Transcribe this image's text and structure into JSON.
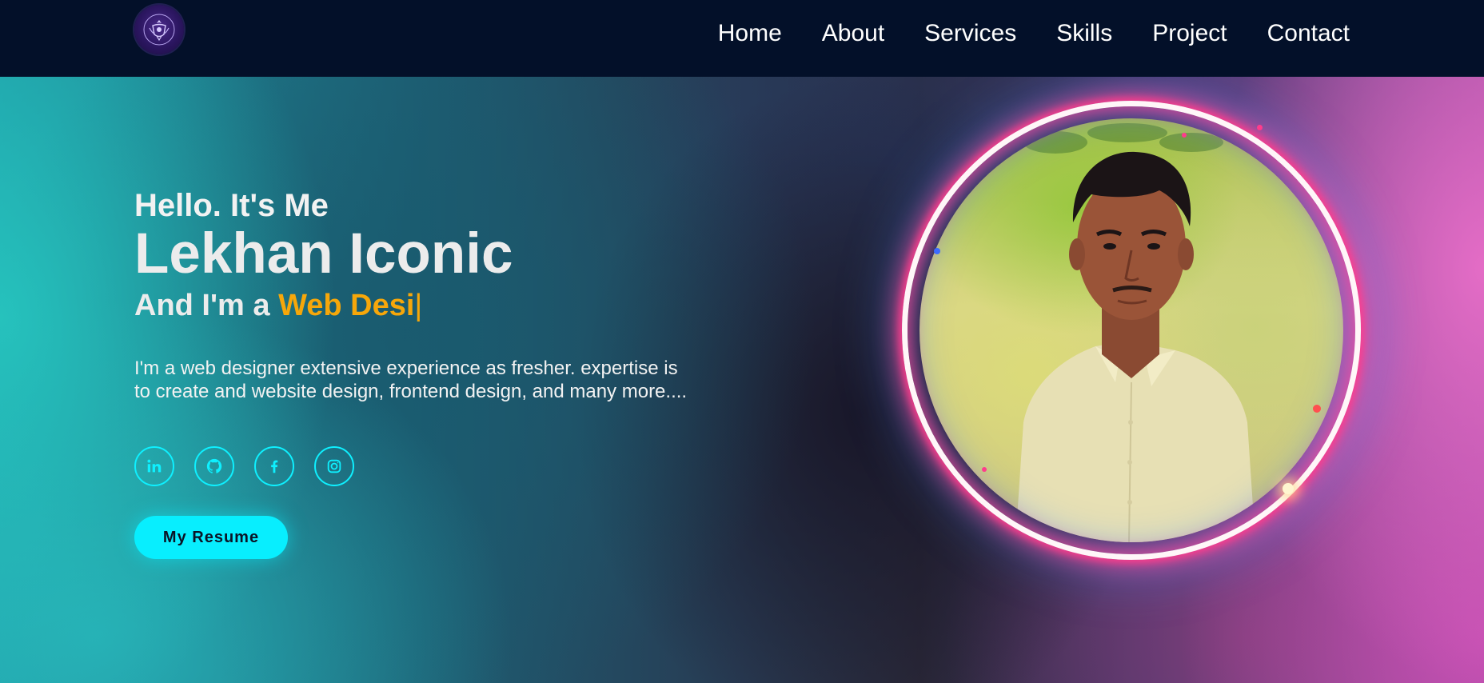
{
  "header": {
    "logo_alt": "Lekhan Iconic logo",
    "nav": [
      "Home",
      "About",
      "Services",
      "Skills",
      "Project",
      "Contact"
    ]
  },
  "hero": {
    "greeting": "Hello. It's Me",
    "name": "Lekhan Iconic",
    "role_prefix": "And I'm a ",
    "role_typed": "Web Desi",
    "cursor": "|",
    "description": "I'm a web designer extensive experience as fresher. expertise is to create and website design, frontend design, and many more....",
    "socials": [
      {
        "name": "linkedin-icon"
      },
      {
        "name": "github-icon"
      },
      {
        "name": "facebook-icon"
      },
      {
        "name": "instagram-icon"
      }
    ],
    "resume_label": "My Resume",
    "portrait_alt": "Portrait of Lekhan Iconic"
  },
  "colors": {
    "header_bg": "#031029",
    "accent_orange": "#f6a70a",
    "accent_cyan": "#08eefe",
    "ring_pink": "#ff3c8c"
  }
}
